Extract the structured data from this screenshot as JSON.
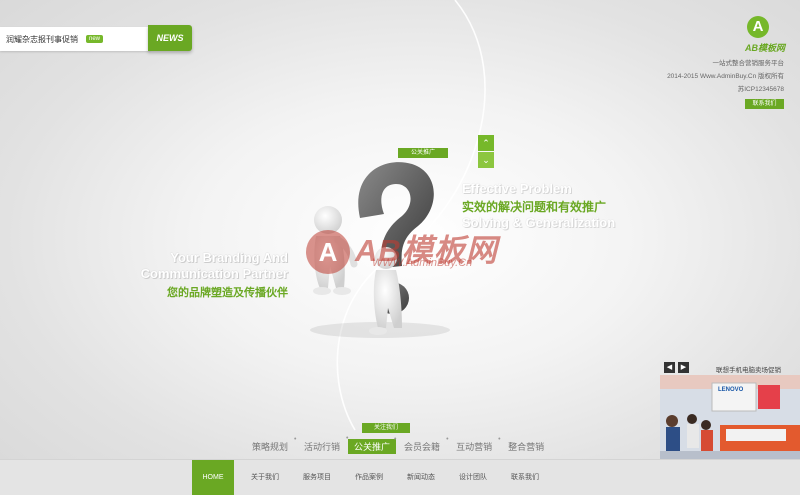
{
  "news": {
    "headline": "润耀杂志报刊事促销",
    "badge": "new",
    "label": "NEWS"
  },
  "brand": {
    "logo_letter": "A",
    "logo_name": "AB模板网",
    "tagline": "一站式整合营销服务平台",
    "copyright": "2014-2015 Www.AdminBuy.Cn 版权所有",
    "icp": "苏ICP12345678",
    "contact_button": "联系我们"
  },
  "hero": {
    "right_tag": "公关推广",
    "right_en_1": "Effective Problem",
    "right_cn": "实效的解决问题和有效推广",
    "right_en_2": "Solving & Generalization",
    "left_en_1": "Your Branding And",
    "left_en_2": "Communication Partner",
    "left_cn": "您的品牌塑造及传播伙伴",
    "arrow_up": "⌃",
    "arrow_down": "⌄"
  },
  "watermark": {
    "letter": "A",
    "text": "AB模板网",
    "url": "WWW.AdminBuy.Cn"
  },
  "categories": {
    "tag": "关注我们",
    "items": [
      "策略规划",
      "活动行销",
      "公关推广",
      "会员会籍",
      "互动营销",
      "整合营销"
    ],
    "active_index": 2
  },
  "nav": {
    "items": [
      "HOME",
      "关于我们",
      "服务项目",
      "作品案例",
      "新闻动态",
      "设计团队",
      "联系我们"
    ],
    "active_index": 0
  },
  "promo": {
    "prev": "◀",
    "next": "▶",
    "title": "联想手机电脑卖场促销",
    "sign": "LENOVO"
  },
  "colors": {
    "accent": "#6aa823",
    "accent_light": "#76b82a",
    "background": "#ececec"
  }
}
